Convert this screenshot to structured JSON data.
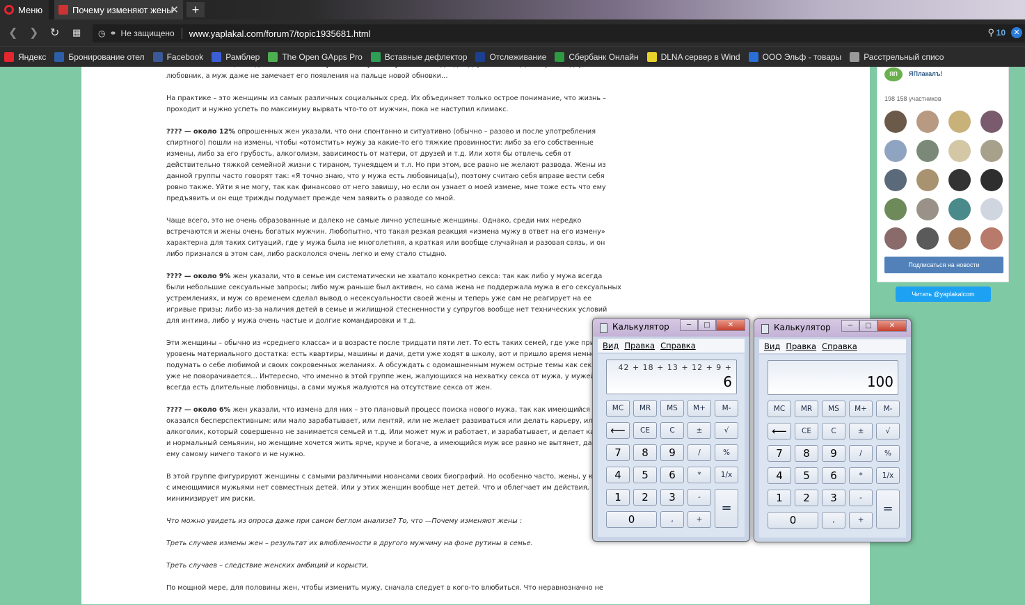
{
  "browser": {
    "menu_label": "Меню",
    "tab_title": "Почему изменяют жены",
    "tab_close": "✕",
    "new_tab": "+",
    "security_label": "Не защищено",
    "url": "www.yaplakal.com/forum7/topic1935681.html",
    "url_badge": "10"
  },
  "bookmarks": [
    {
      "label": "Яндекс",
      "color": "#e4262f"
    },
    {
      "label": "Бронирование отел",
      "color": "#2c5fa8"
    },
    {
      "label": "Facebook",
      "color": "#3b5998"
    },
    {
      "label": "Рамблер",
      "color": "#3c5fd8"
    },
    {
      "label": "The Open GApps Pro",
      "color": "#4caf50"
    },
    {
      "label": "Вставные дефлектор",
      "color": "#2f9e55"
    },
    {
      "label": "Отслеживание",
      "color": "#1c3f8f"
    },
    {
      "label": "Сбербанк Онлайн",
      "color": "#2e9a42"
    },
    {
      "label": "DLNA сервер в Wind",
      "color": "#e8d22a"
    },
    {
      "label": "ООО Эльф - товары",
      "color": "#2a6fd6"
    },
    {
      "label": "Расстрельный списо",
      "color": "#999999"
    }
  ],
  "article": {
    "p0": "женские аппетиты, иногда – ненасытны: к купленной мужем шубе очень подходит дорогое кольцо, который подарил любовник, а муж даже не замечает его появления на пальце новой обновки…",
    "p1": "На практике – это женщины из самых различных социальных сред. Их объединяет только острое понимание, что жизнь – проходит и нужно успеть по максимуму вырвать что-то от мужчин, пока не наступил климакс.",
    "p2_bold": "???? — около 12%",
    "p2": " опрошенных жен указали, что они спонтанно и ситуативно (обычно – разово и после употребления спиртного) пошли на измены, чтобы «отомстить» мужу за какие-то его тяжкие провинности: либо за его собственные измены, либо за его грубость, алкоголизм, зависимость от матери, от друзей и т.д. Или хотя бы отвлечь себя от действительно тяжкой семейной жизни с тираном, тунеядцем и т.л. Но при этом, все равно не желают развода. Жены из данной группы часто говорят так: «Я точно знаю, что у мужа есть любовница(ы), поэтому считаю себя вправе вести себя ровно также. Уйти я не могу, так как финансово от него завишу, но если он узнает о моей измене, мне тоже есть что ему предъявить и он еще трижды подумает прежде чем заявить о разводе со мной.",
    "p3": "Чаще всего, это не очень образованные и далеко не самые лично успешные женщины. Однако, среди них нередко встречаются и жены очень богатых мужчин. Любопытно, что такая резкая реакция «измена мужу в ответ на его измену» характерна для таких ситуаций, где у мужа была не многолетняя, а краткая или вообще случайная и разовая связь, и он либо признался в этом сам, либо раскололся очень легко и ему стало стыдно.",
    "p4_bold": "???? — около 9%",
    "p4": " жен указали, что в семье им систематически не хватало конкретно секса: так как либо у мужа всегда были небольшие сексуальные запросы; либо муж раньше был активен, но сама жена не поддержала мужа в его сексуальных устремлениях, и муж со временем сделал вывод о несексуальности своей жены и теперь уже сам не реагирует на ее игривые призы; либо из-за наличия детей в семье и жилищной стесненности у супругов вообще нет технических условий для интима, либо у мужа очень частые и долгие командировки и т.д.",
    "p5": "Эти женщины – обычно из «среднего класса» и в возрасте после тридцати пяти лет. То есть таких семей, где уже приличный уровень материального достатка: есть квартиры, машины и дачи, дети уже ходят в школу, вот и пришло время немного подумать о себе любимой и своих сокровенных желаниях. А обсуждать с одомашненным мужем острые темы как секс, язык уже не поворачивается… Интересно, что именно в этой группе жен, жалующихся на нехватку секса от мужа, у мужей почти всегда есть длительные любовницы, а сами мужья жалуются на отсутствие секса от жен.",
    "p6_bold": "???? — около 6%",
    "p6": " жен указали, что измена для них – это плановый процесс поиска нового мужа, так как имеющийся оказался бесперспективным: или мало зарабатывает, или лентяй, или не желает развиваться или делать карьеру, или алкоголик, который совершенно не занимается семьей и т.д. Или может муж и работает, и зарабатывает, и делает карьеру, и нормальный семьянин, но женщине хочется жить ярче, круче и богаче, а имеющийся муж все равно не вытянет, да плюс ему самому ничего такого и не нужно.",
    "p7": "В этой группе фигурируют женщины с самыми различными нюансами своих биографий. Но особенно часто, жены, у которых с имеющимися мужьями нет совместных детей. Или у этих женщин вообще нет детей. Что и облегчает им действия, минимизирует им риски.",
    "p8": "Что можно увидеть из опроса даже при самом беглом анализе? То, что —Почему изменяют жены :",
    "p9": "Треть случаев измены жен – результат их влюбленности в другого мужчину на фоне рутины в семье.",
    "p10": "Треть случаев – следствие женских амбиций и корысти,",
    "p11": "По мощной мере, для половины жен, чтобы изменить мужу, сначала следует в кого-то влюбиться. Что неравнозначно не"
  },
  "sidebar": {
    "group_logo": "ЯП",
    "group_name": "ЯПлакалъ!",
    "members": "198 158 участников",
    "subscribe_button": "Подписаться на новости",
    "twitter_button": "Читать @yaplakalcom"
  },
  "calc1": {
    "title": "Калькулятор",
    "menu": [
      "Вид",
      "Правка",
      "Справка"
    ],
    "expression": "42 + 18 + 13 + 12 + 9 +",
    "result": "6"
  },
  "calc2": {
    "title": "Калькулятор",
    "menu": [
      "Вид",
      "Правка",
      "Справка"
    ],
    "expression": "",
    "result": "100"
  },
  "calc_keys": {
    "mc": "MC",
    "mr": "MR",
    "ms": "MS",
    "mplus": "M+",
    "mminus": "M-",
    "back": "⟵",
    "ce": "CE",
    "c": "C",
    "pm": "±",
    "sqrt": "√",
    "k7": "7",
    "k8": "8",
    "k9": "9",
    "div": "/",
    "pct": "%",
    "k4": "4",
    "k5": "5",
    "k6": "6",
    "mul": "*",
    "inv": "1/x",
    "k1": "1",
    "k2": "2",
    "k3": "3",
    "sub": "-",
    "eq": "=",
    "k0": "0",
    "dot": ",",
    "add": "+"
  }
}
